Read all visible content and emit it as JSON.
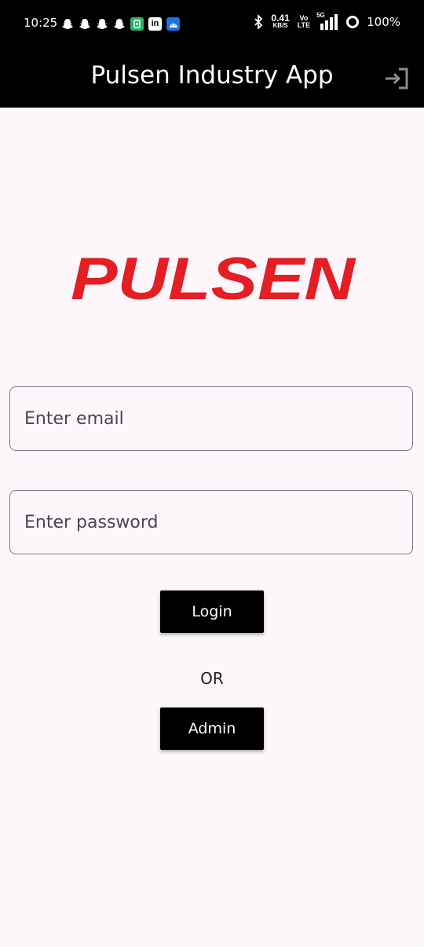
{
  "status_bar": {
    "time": "10:25",
    "notification_icons": [
      "snapchat-icon",
      "snapchat-icon",
      "snapchat-icon",
      "snapchat-icon",
      "app-icon",
      "linkedin-icon",
      "android-icon"
    ],
    "net_speed": "0.41",
    "net_speed_unit": "KB/S",
    "volte_top": "Vo",
    "volte_bottom": "LTE",
    "network": "5G",
    "battery": "100%"
  },
  "app_bar": {
    "title": "Pulsen Industry App",
    "logout_icon": "logout-icon"
  },
  "logo": {
    "text": "PULSEN",
    "color": "#e31e24"
  },
  "form": {
    "email_placeholder": "Enter email",
    "email_value": "",
    "password_placeholder": "Enter password",
    "password_value": "",
    "login_label": "Login",
    "separator": "OR",
    "admin_label": "Admin"
  },
  "colors": {
    "background": "#fdf7fc",
    "bar": "#000000",
    "button": "#000000",
    "logo_red": "#e31e24"
  }
}
